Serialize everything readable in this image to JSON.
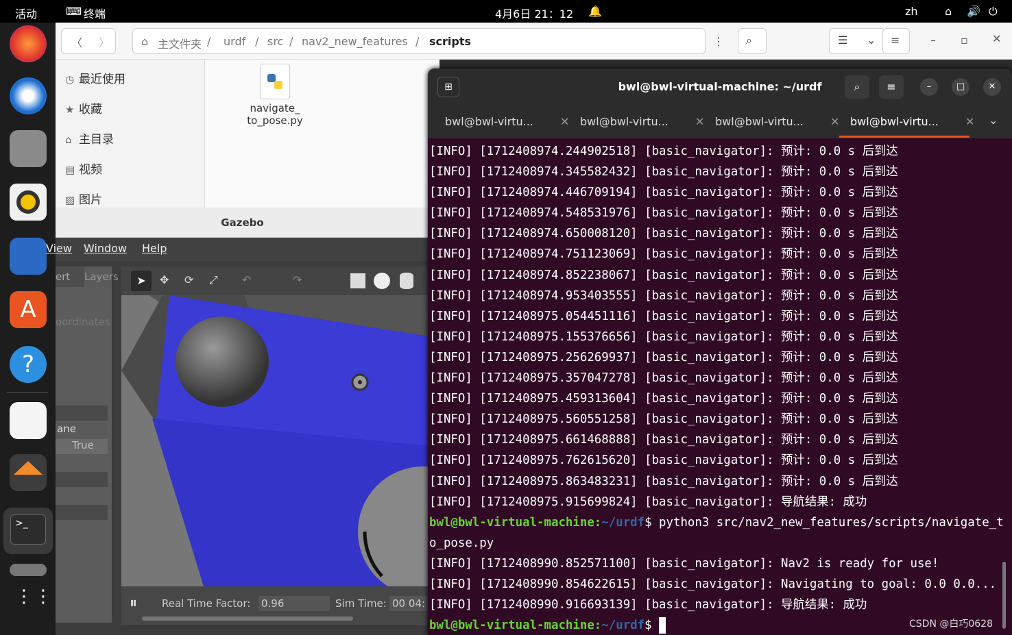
{
  "topbar": {
    "activities": "活动",
    "app": "终端",
    "clock": "4月6日  21：12",
    "lang": "zh"
  },
  "files": {
    "path": [
      "主文件夹",
      "urdf",
      "src",
      "nav2_new_features",
      "scripts"
    ],
    "sidebar": [
      "最近使用",
      "收藏",
      "主目录",
      "视频",
      "图片"
    ],
    "file_name_1": "navigate_",
    "file_name_2": "to_pose.py"
  },
  "gazebo": {
    "title": "Gazebo",
    "menu": [
      "View",
      "Window",
      "Help"
    ],
    "left_tabs": [
      "ert",
      "Layers"
    ],
    "left_fragments": [
      "oordinates",
      "ane",
      "True"
    ],
    "status_rtf_label": "Real Time Factor:",
    "status_rtf_value": "0.96",
    "status_sim_label": "Sim Time:",
    "status_sim_value": "00 04:"
  },
  "terminal": {
    "title": "bwl@bwl-virtual-machine: ~/urdf",
    "tabs": [
      "bwl@bwl-virtu...",
      "bwl@bwl-virtu...",
      "bwl@bwl-virtu...",
      "bwl@bwl-virtu..."
    ],
    "lines": [
      "[INFO] [1712408974.244902518] [basic_navigator]: 预计: 0.0 s 后到达",
      "[INFO] [1712408974.345582432] [basic_navigator]: 预计: 0.0 s 后到达",
      "[INFO] [1712408974.446709194] [basic_navigator]: 预计: 0.0 s 后到达",
      "[INFO] [1712408974.548531976] [basic_navigator]: 预计: 0.0 s 后到达",
      "[INFO] [1712408974.650008120] [basic_navigator]: 预计: 0.0 s 后到达",
      "[INFO] [1712408974.751123069] [basic_navigator]: 预计: 0.0 s 后到达",
      "[INFO] [1712408974.852238067] [basic_navigator]: 预计: 0.0 s 后到达",
      "[INFO] [1712408974.953403555] [basic_navigator]: 预计: 0.0 s 后到达",
      "[INFO] [1712408975.054451116] [basic_navigator]: 预计: 0.0 s 后到达",
      "[INFO] [1712408975.155376656] [basic_navigator]: 预计: 0.0 s 后到达",
      "[INFO] [1712408975.256269937] [basic_navigator]: 预计: 0.0 s 后到达",
      "[INFO] [1712408975.357047278] [basic_navigator]: 预计: 0.0 s 后到达",
      "[INFO] [1712408975.459313604] [basic_navigator]: 预计: 0.0 s 后到达",
      "[INFO] [1712408975.560551258] [basic_navigator]: 预计: 0.0 s 后到达",
      "[INFO] [1712408975.661468888] [basic_navigator]: 预计: 0.0 s 后到达",
      "[INFO] [1712408975.762615620] [basic_navigator]: 预计: 0.0 s 后到达",
      "[INFO] [1712408975.863483231] [basic_navigator]: 预计: 0.0 s 后到达",
      "[INFO] [1712408975.915699824] [basic_navigator]: 导航结果: 成功"
    ],
    "prompt_user": "bwl@bwl-virtual-machine:",
    "prompt_path": "~/urdf",
    "command_1": "$ python3 src/nav2_new_features/scripts/navigate_t",
    "command_2": "o_pose.py",
    "lines2": [
      "[INFO] [1712408990.852571100] [basic_navigator]: Nav2 is ready for use!",
      "[INFO] [1712408990.854622615] [basic_navigator]: Navigating to goal: 0.0 0.0...",
      "[INFO] [1712408990.916693139] [basic_navigator]: 导航结果: 成功"
    ],
    "final_prompt_end": "$ "
  },
  "watermark": "CSDN @白巧0628"
}
